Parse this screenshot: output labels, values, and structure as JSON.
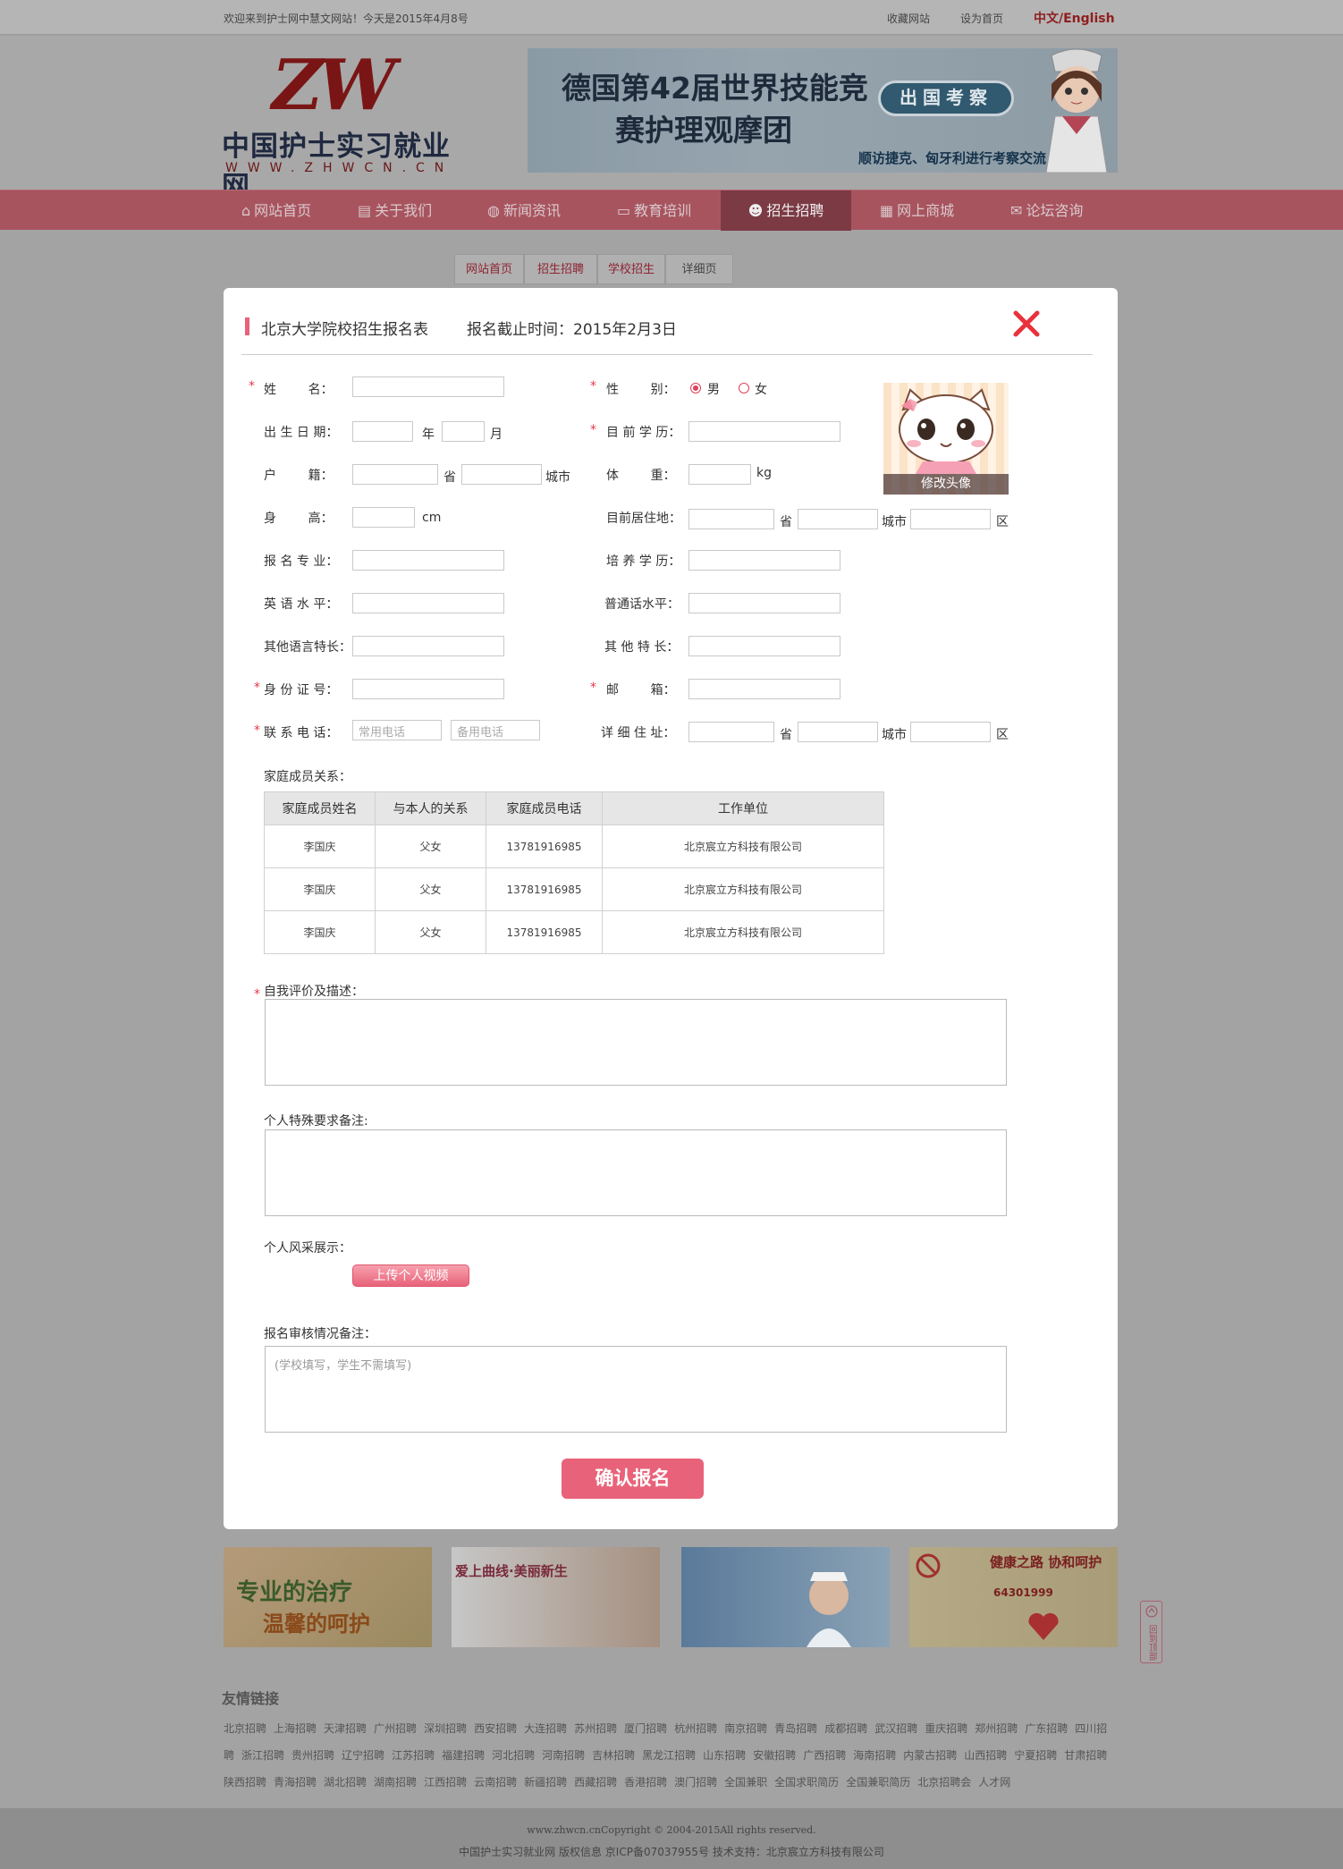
{
  "topbar": {
    "welcome": "欢迎来到护士网中慧文网站！今天是2015年4月8号",
    "favorite": "收藏网站",
    "set_home": "设为首页",
    "language": "中文/English"
  },
  "logo": {
    "mark": "ZW",
    "name": "中国护士实习就业网",
    "url": "WWW.ZHWCN.CN"
  },
  "banner": {
    "line1": "德国第42届世界技能竞",
    "line2": "赛护理观摩团",
    "button": "出国考察",
    "sub": "顺访捷克、匈牙利进行考察交流"
  },
  "nav": [
    {
      "label": "网站首页",
      "icon": "home-icon"
    },
    {
      "label": "关于我们",
      "icon": "book-icon"
    },
    {
      "label": "新闻资讯",
      "icon": "globe-icon"
    },
    {
      "label": "教育培训",
      "icon": "monitor-icon"
    },
    {
      "label": "招生招聘",
      "icon": "users-icon",
      "active": true
    },
    {
      "label": "网上商城",
      "icon": "shop-icon"
    },
    {
      "label": "论坛咨询",
      "icon": "chat-icon"
    }
  ],
  "breadcrumb": [
    "网站首页",
    "招生招聘",
    "学校招生",
    "详细页"
  ],
  "form": {
    "title": "北京大学院校招生报名表",
    "deadline": "报名截止时间：2015年2月3日",
    "labels": {
      "name": "姓        名：",
      "gender": "性        别：",
      "male": "男",
      "female": "女",
      "birth": "出 生 日 期：",
      "year": "年",
      "month": "月",
      "education": "目 前 学 历：",
      "hukou": "户        籍：",
      "province": "省",
      "city": "城市",
      "district": "区",
      "weight": "体        重：",
      "kg": "kg",
      "height": "身        高：",
      "cm": "cm",
      "residence": "目前居住地：",
      "major": "报 名 专 业：",
      "train_edu": "培 养 学 历：",
      "english": "英 语 水 平：",
      "mandarin": "普通话水平：",
      "other_lang": "其他语言特长：",
      "other_skill": "其 他 特 长：",
      "id_no": "身 份 证 号：",
      "email": "邮        箱：",
      "phone": "联 系 电 话：",
      "address": "详 细 住 址：",
      "family": "家庭成员关系：",
      "self_eval": "自我评价及描述：",
      "special": "个人特殊要求备注:",
      "showcase": "个人风采展示：",
      "review": "报名审核情况备注："
    },
    "placeholders": {
      "phone1": "常用电话",
      "phone2": "备用电话",
      "review": "(学校填写，学生不需填写)"
    },
    "avatar_caption": "修改头像",
    "family_table": {
      "headers": [
        "家庭成员姓名",
        "与本人的关系",
        "家庭成员电话",
        "工作单位"
      ],
      "rows": [
        [
          "李国庆",
          "父女",
          "13781916985",
          "北京宸立方科技有限公司"
        ],
        [
          "李国庆",
          "父女",
          "13781916985",
          "北京宸立方科技有限公司"
        ],
        [
          "李国庆",
          "父女",
          "13781916985",
          "北京宸立方科技有限公司"
        ]
      ]
    },
    "upload_button": "上传个人视频",
    "confirm_button": "确认报名"
  },
  "ads": [
    {
      "text1": "专业的治疗",
      "text2": "温馨的呵护"
    },
    {
      "text1": "爱上曲线·美丽新生",
      "text2": ""
    },
    {
      "text1": "",
      "text2": ""
    },
    {
      "text1": "健康之路  协和呵护",
      "text2": "64301999"
    }
  ],
  "side_tab": "回到顶部",
  "friend_links": {
    "title": "友情链接",
    "items": [
      "北京招聘",
      "上海招聘",
      "天津招聘",
      "广州招聘",
      "深圳招聘",
      "西安招聘",
      "大连招聘",
      "苏州招聘",
      "厦门招聘",
      "杭州招聘",
      "南京招聘",
      "青岛招聘",
      "成都招聘",
      "武汉招聘",
      "重庆招聘",
      "郑州招聘",
      "广东招聘",
      "四川招聘",
      "浙江招聘",
      "贵州招聘",
      "辽宁招聘",
      "江苏招聘",
      "福建招聘",
      "河北招聘",
      "河南招聘",
      "吉林招聘",
      "黑龙江招聘",
      "山东招聘",
      "安徽招聘",
      "广西招聘",
      "海南招聘",
      "内蒙古招聘",
      "山西招聘",
      "宁夏招聘",
      "甘肃招聘",
      "陕西招聘",
      "青海招聘",
      "湖北招聘",
      "湖南招聘",
      "江西招聘",
      "云南招聘",
      "新疆招聘",
      "西藏招聘",
      "香港招聘",
      "澳门招聘",
      "全国兼职",
      "全国求职简历",
      "全国兼职简历",
      "北京招聘会",
      "人才网"
    ]
  },
  "footer": {
    "copyright": "www.zhwcn.cnCopyright © 2004-2015All rights reserved.",
    "info": "中国护士实习就业网  版权信息  京ICP备07037955号   技术支持：北京宸立方科技有限公司"
  }
}
